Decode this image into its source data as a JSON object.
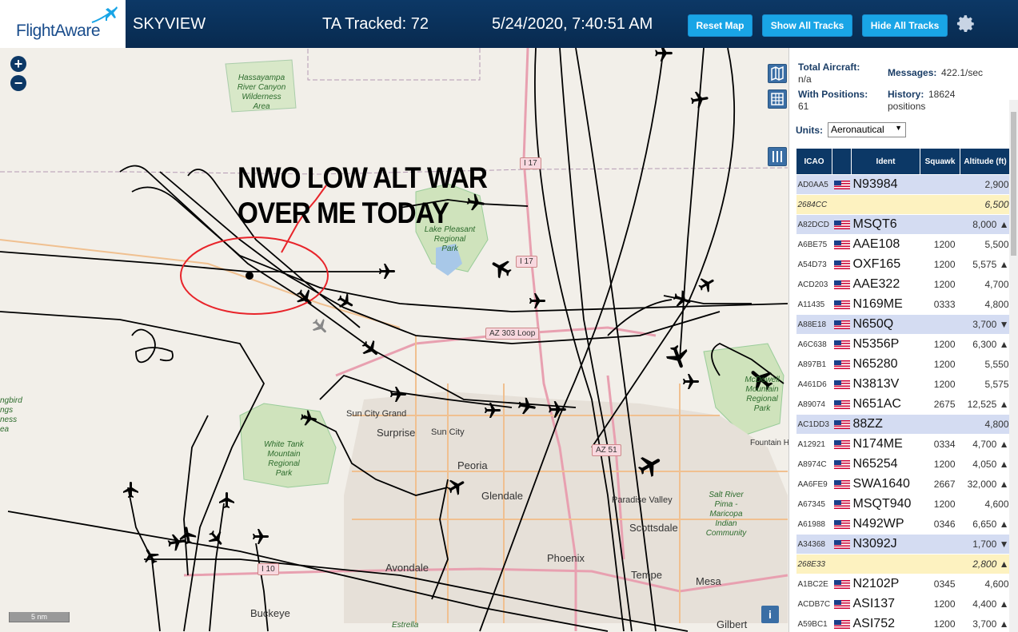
{
  "header": {
    "logo_text": "FlightAware",
    "app_name": "SKYVIEW",
    "ta_tracked": "TA Tracked: 72",
    "clock": "5/24/2020, 7:40:51 AM",
    "reset_map_label": "Reset Map",
    "show_all_tracks_label": "Show All Tracks",
    "hide_all_tracks_label": "Hide All Tracks"
  },
  "map": {
    "annotation_line1": "NWO LOW ALT WAR",
    "annotation_line2": "OVER ME TODAY",
    "scale_label": "5 nm",
    "info_label": "i",
    "zoom_in": "+",
    "zoom_out": "−",
    "places": {
      "surprise": "Surprise",
      "sun_city": "Sun City",
      "sun_city_grand": "Sun City Grand",
      "peoria": "Peoria",
      "glendale": "Glendale",
      "phoenix": "Phoenix",
      "avondale": "Avondale",
      "buckeye": "Buckeye",
      "scottsdale": "Scottsdale",
      "paradise_valley": "Paradise Valley",
      "tempe": "Tempe",
      "mesa": "Mesa",
      "gilbert": "Gilbert",
      "fountain": "Fountain H",
      "estrella": "Estrella"
    },
    "parks": {
      "hassayampa": "Hassayampa\nRiver Canyon\nWilderness\nArea",
      "lake_pleasant": "Lake Pleasant\nRegional\nPark",
      "white_tank": "White Tank\nMountain\nRegional\nPark",
      "mcdowell": "McDowell\nMountain\nRegional\nPark",
      "salt_river": "Salt River\nPima -\nMaricopa\nIndian\nCommunity",
      "hummingbird": "ngbird\nngs\nness\nea"
    },
    "roads": {
      "i17_north": "I 17",
      "i17_mid": "I 17",
      "az303": "AZ 303 Loop",
      "az51": "AZ 51",
      "i10": "I 10"
    }
  },
  "panel": {
    "total_aircraft_label": "Total Aircraft:",
    "total_aircraft_value": "n/a",
    "with_positions_label": "With Positions:",
    "with_positions_value": "61",
    "messages_label": "Messages:",
    "messages_value": "422.1/sec",
    "history_label": "History:",
    "history_value": "18624",
    "history_unit": "positions",
    "units_label": "Units:",
    "units_value": "Aeronautical",
    "columns": [
      "ICAO",
      "",
      "Ident",
      "Squawk",
      "Altitude (ft)"
    ],
    "rows": [
      {
        "icao": "AD0AA5",
        "flag": true,
        "ident": "N93984",
        "squawk": "",
        "alt": "2,900",
        "style": "blue"
      },
      {
        "icao": "2684CC",
        "flag": false,
        "ident": "",
        "squawk": "",
        "alt": "6,500",
        "style": "yellow"
      },
      {
        "icao": "A82DCD",
        "flag": true,
        "ident": "MSQT6",
        "squawk": "",
        "alt": "8,000 ▲",
        "style": "blue"
      },
      {
        "icao": "A6BE75",
        "flag": true,
        "ident": "AAE108",
        "squawk": "1200",
        "alt": "5,500",
        "style": "white"
      },
      {
        "icao": "A54D73",
        "flag": true,
        "ident": "OXF165",
        "squawk": "1200",
        "alt": "5,575 ▲",
        "style": "white"
      },
      {
        "icao": "ACD203",
        "flag": true,
        "ident": "AAE322",
        "squawk": "1200",
        "alt": "4,700",
        "style": "white"
      },
      {
        "icao": "A11435",
        "flag": true,
        "ident": "N169ME",
        "squawk": "0333",
        "alt": "4,800",
        "style": "white"
      },
      {
        "icao": "A88E18",
        "flag": true,
        "ident": "N650Q",
        "squawk": "",
        "alt": "3,700 ▼",
        "style": "blue"
      },
      {
        "icao": "A6C638",
        "flag": true,
        "ident": "N5356P",
        "squawk": "1200",
        "alt": "6,300 ▲",
        "style": "white"
      },
      {
        "icao": "A897B1",
        "flag": true,
        "ident": "N65280",
        "squawk": "1200",
        "alt": "5,550",
        "style": "white"
      },
      {
        "icao": "A461D6",
        "flag": true,
        "ident": "N3813V",
        "squawk": "1200",
        "alt": "5,575",
        "style": "white"
      },
      {
        "icao": "A89074",
        "flag": true,
        "ident": "N651AC",
        "squawk": "2675",
        "alt": "12,525 ▲",
        "style": "white"
      },
      {
        "icao": "AC1DD3",
        "flag": true,
        "ident": "88ZZ",
        "squawk": "",
        "alt": "4,800",
        "style": "blue"
      },
      {
        "icao": "A12921",
        "flag": true,
        "ident": "N174ME",
        "squawk": "0334",
        "alt": "4,700 ▲",
        "style": "white"
      },
      {
        "icao": "A8974C",
        "flag": true,
        "ident": "N65254",
        "squawk": "1200",
        "alt": "4,050 ▲",
        "style": "white"
      },
      {
        "icao": "AA6FE9",
        "flag": true,
        "ident": "SWA1640",
        "squawk": "2667",
        "alt": "32,000 ▲",
        "style": "white"
      },
      {
        "icao": "A67345",
        "flag": true,
        "ident": "MSQT940",
        "squawk": "1200",
        "alt": "4,600",
        "style": "white"
      },
      {
        "icao": "A61988",
        "flag": true,
        "ident": "N492WP",
        "squawk": "0346",
        "alt": "6,650 ▲",
        "style": "white"
      },
      {
        "icao": "A34368",
        "flag": true,
        "ident": "N3092J",
        "squawk": "",
        "alt": "1,700 ▼",
        "style": "blue"
      },
      {
        "icao": "268E33",
        "flag": false,
        "ident": "",
        "squawk": "",
        "alt": "2,800 ▲",
        "style": "yellow"
      },
      {
        "icao": "A1BC2E",
        "flag": true,
        "ident": "N2102P",
        "squawk": "0345",
        "alt": "4,600",
        "style": "white"
      },
      {
        "icao": "ACDB7C",
        "flag": true,
        "ident": "ASI137",
        "squawk": "1200",
        "alt": "4,400 ▲",
        "style": "white"
      },
      {
        "icao": "A59BC1",
        "flag": true,
        "ident": "ASI752",
        "squawk": "1200",
        "alt": "3,700 ▲",
        "style": "white"
      }
    ]
  },
  "colors": {
    "header_bg": "#0c3866",
    "button_bg": "#19a5e6",
    "row_blue": "#d4dcf2",
    "row_yellow": "#fdf2c0",
    "annotation_circle": "#e8242a"
  }
}
